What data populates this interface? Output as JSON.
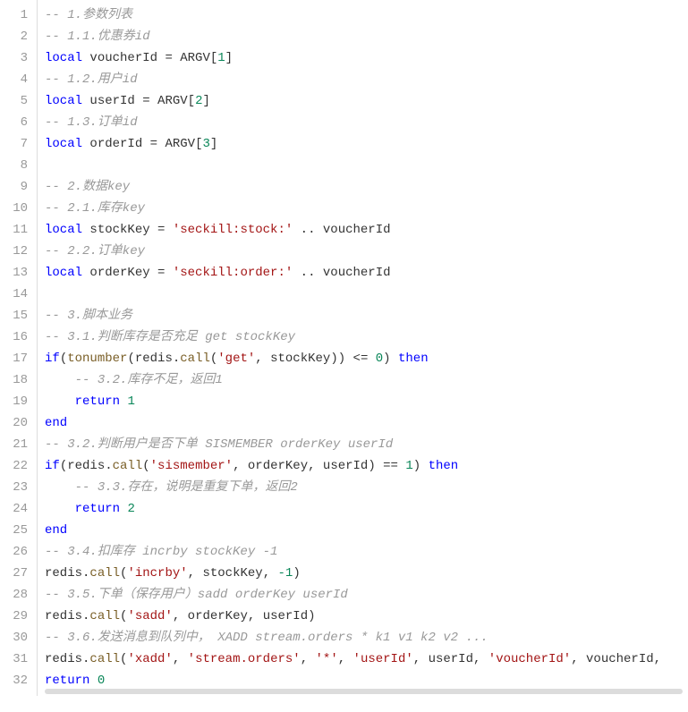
{
  "max_lines": 32,
  "lines": [
    [
      {
        "c": "cm",
        "t": "-- 1.参数列表"
      }
    ],
    [
      {
        "c": "cm",
        "t": "-- 1.1.优惠券id"
      }
    ],
    [
      {
        "c": "kw",
        "t": "local"
      },
      {
        "c": "id",
        "t": " voucherId "
      },
      {
        "c": "op",
        "t": "="
      },
      {
        "c": "id",
        "t": " ARGV"
      },
      {
        "c": "op",
        "t": "["
      },
      {
        "c": "num",
        "t": "1"
      },
      {
        "c": "op",
        "t": "]"
      }
    ],
    [
      {
        "c": "cm",
        "t": "-- 1.2.用户id"
      }
    ],
    [
      {
        "c": "kw",
        "t": "local"
      },
      {
        "c": "id",
        "t": " userId "
      },
      {
        "c": "op",
        "t": "="
      },
      {
        "c": "id",
        "t": " ARGV"
      },
      {
        "c": "op",
        "t": "["
      },
      {
        "c": "num",
        "t": "2"
      },
      {
        "c": "op",
        "t": "]"
      }
    ],
    [
      {
        "c": "cm",
        "t": "-- 1.3.订单id"
      }
    ],
    [
      {
        "c": "kw",
        "t": "local"
      },
      {
        "c": "id",
        "t": " orderId "
      },
      {
        "c": "op",
        "t": "="
      },
      {
        "c": "id",
        "t": " ARGV"
      },
      {
        "c": "op",
        "t": "["
      },
      {
        "c": "num",
        "t": "3"
      },
      {
        "c": "op",
        "t": "]"
      }
    ],
    [],
    [
      {
        "c": "cm",
        "t": "-- 2.数据key"
      }
    ],
    [
      {
        "c": "cm",
        "t": "-- 2.1.库存key"
      }
    ],
    [
      {
        "c": "kw",
        "t": "local"
      },
      {
        "c": "id",
        "t": " stockKey "
      },
      {
        "c": "op",
        "t": "="
      },
      {
        "c": "id",
        "t": " "
      },
      {
        "c": "str",
        "t": "'seckill:stock:'"
      },
      {
        "c": "id",
        "t": " "
      },
      {
        "c": "op",
        "t": ".."
      },
      {
        "c": "id",
        "t": " voucherId"
      }
    ],
    [
      {
        "c": "cm",
        "t": "-- 2.2.订单key"
      }
    ],
    [
      {
        "c": "kw",
        "t": "local"
      },
      {
        "c": "id",
        "t": " orderKey "
      },
      {
        "c": "op",
        "t": "="
      },
      {
        "c": "id",
        "t": " "
      },
      {
        "c": "str",
        "t": "'seckill:order:'"
      },
      {
        "c": "id",
        "t": " "
      },
      {
        "c": "op",
        "t": ".."
      },
      {
        "c": "id",
        "t": " voucherId"
      }
    ],
    [],
    [
      {
        "c": "cm",
        "t": "-- 3.脚本业务"
      }
    ],
    [
      {
        "c": "cm",
        "t": "-- 3.1.判断库存是否充足 get stockKey"
      }
    ],
    [
      {
        "c": "kw",
        "t": "if"
      },
      {
        "c": "op",
        "t": "("
      },
      {
        "c": "fn",
        "t": "tonumber"
      },
      {
        "c": "op",
        "t": "("
      },
      {
        "c": "id",
        "t": "redis"
      },
      {
        "c": "op",
        "t": "."
      },
      {
        "c": "fn",
        "t": "call"
      },
      {
        "c": "op",
        "t": "("
      },
      {
        "c": "str",
        "t": "'get'"
      },
      {
        "c": "op",
        "t": ","
      },
      {
        "c": "id",
        "t": " stockKey"
      },
      {
        "c": "op",
        "t": "))"
      },
      {
        "c": "id",
        "t": " "
      },
      {
        "c": "op",
        "t": "<="
      },
      {
        "c": "id",
        "t": " "
      },
      {
        "c": "num",
        "t": "0"
      },
      {
        "c": "op",
        "t": ")"
      },
      {
        "c": "id",
        "t": " "
      },
      {
        "c": "kw",
        "t": "then"
      }
    ],
    [
      {
        "c": "id",
        "t": "    "
      },
      {
        "c": "cm",
        "t": "-- 3.2.库存不足，返回1"
      }
    ],
    [
      {
        "c": "id",
        "t": "    "
      },
      {
        "c": "kw",
        "t": "return"
      },
      {
        "c": "id",
        "t": " "
      },
      {
        "c": "num",
        "t": "1"
      }
    ],
    [
      {
        "c": "kw",
        "t": "end"
      }
    ],
    [
      {
        "c": "cm",
        "t": "-- 3.2.判断用户是否下单 SISMEMBER orderKey userId"
      }
    ],
    [
      {
        "c": "kw",
        "t": "if"
      },
      {
        "c": "op",
        "t": "("
      },
      {
        "c": "id",
        "t": "redis"
      },
      {
        "c": "op",
        "t": "."
      },
      {
        "c": "fn",
        "t": "call"
      },
      {
        "c": "op",
        "t": "("
      },
      {
        "c": "str",
        "t": "'sismember'"
      },
      {
        "c": "op",
        "t": ","
      },
      {
        "c": "id",
        "t": " orderKey"
      },
      {
        "c": "op",
        "t": ","
      },
      {
        "c": "id",
        "t": " userId"
      },
      {
        "c": "op",
        "t": ")"
      },
      {
        "c": "id",
        "t": " "
      },
      {
        "c": "op",
        "t": "=="
      },
      {
        "c": "id",
        "t": " "
      },
      {
        "c": "num",
        "t": "1"
      },
      {
        "c": "op",
        "t": ")"
      },
      {
        "c": "id",
        "t": " "
      },
      {
        "c": "kw",
        "t": "then"
      }
    ],
    [
      {
        "c": "id",
        "t": "    "
      },
      {
        "c": "cm",
        "t": "-- 3.3.存在，说明是重复下单，返回2"
      }
    ],
    [
      {
        "c": "id",
        "t": "    "
      },
      {
        "c": "kw",
        "t": "return"
      },
      {
        "c": "id",
        "t": " "
      },
      {
        "c": "num",
        "t": "2"
      }
    ],
    [
      {
        "c": "kw",
        "t": "end"
      }
    ],
    [
      {
        "c": "cm",
        "t": "-- 3.4.扣库存 incrby stockKey -1"
      }
    ],
    [
      {
        "c": "id",
        "t": "redis"
      },
      {
        "c": "op",
        "t": "."
      },
      {
        "c": "fn",
        "t": "call"
      },
      {
        "c": "op",
        "t": "("
      },
      {
        "c": "str",
        "t": "'incrby'"
      },
      {
        "c": "op",
        "t": ","
      },
      {
        "c": "id",
        "t": " stockKey"
      },
      {
        "c": "op",
        "t": ","
      },
      {
        "c": "id",
        "t": " "
      },
      {
        "c": "num",
        "t": "-1"
      },
      {
        "c": "op",
        "t": ")"
      }
    ],
    [
      {
        "c": "cm",
        "t": "-- 3.5.下单（保存用户）sadd orderKey userId"
      }
    ],
    [
      {
        "c": "id",
        "t": "redis"
      },
      {
        "c": "op",
        "t": "."
      },
      {
        "c": "fn",
        "t": "call"
      },
      {
        "c": "op",
        "t": "("
      },
      {
        "c": "str",
        "t": "'sadd'"
      },
      {
        "c": "op",
        "t": ","
      },
      {
        "c": "id",
        "t": " orderKey"
      },
      {
        "c": "op",
        "t": ","
      },
      {
        "c": "id",
        "t": " userId"
      },
      {
        "c": "op",
        "t": ")"
      }
    ],
    [
      {
        "c": "cm",
        "t": "-- 3.6.发送消息到队列中， XADD stream.orders * k1 v1 k2 v2 ..."
      }
    ],
    [
      {
        "c": "id",
        "t": "redis"
      },
      {
        "c": "op",
        "t": "."
      },
      {
        "c": "fn",
        "t": "call"
      },
      {
        "c": "op",
        "t": "("
      },
      {
        "c": "str",
        "t": "'xadd'"
      },
      {
        "c": "op",
        "t": ","
      },
      {
        "c": "id",
        "t": " "
      },
      {
        "c": "str",
        "t": "'stream.orders'"
      },
      {
        "c": "op",
        "t": ","
      },
      {
        "c": "id",
        "t": " "
      },
      {
        "c": "str",
        "t": "'*'"
      },
      {
        "c": "op",
        "t": ","
      },
      {
        "c": "id",
        "t": " "
      },
      {
        "c": "str",
        "t": "'userId'"
      },
      {
        "c": "op",
        "t": ","
      },
      {
        "c": "id",
        "t": " userId"
      },
      {
        "c": "op",
        "t": ","
      },
      {
        "c": "id",
        "t": " "
      },
      {
        "c": "str",
        "t": "'voucherId'"
      },
      {
        "c": "op",
        "t": ","
      },
      {
        "c": "id",
        "t": " voucherId"
      },
      {
        "c": "op",
        "t": ","
      }
    ],
    [
      {
        "c": "kw",
        "t": "return"
      },
      {
        "c": "id",
        "t": " "
      },
      {
        "c": "num",
        "t": "0"
      }
    ]
  ]
}
